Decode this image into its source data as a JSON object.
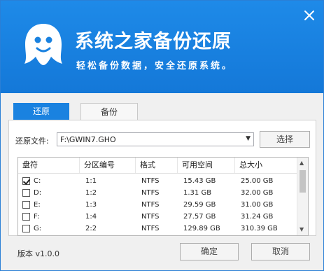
{
  "header": {
    "title": "系统之家备份还原",
    "slogan": "轻松备份数据，安全还原系统。"
  },
  "tabs": [
    {
      "label": "还原",
      "active": true
    },
    {
      "label": "备份",
      "active": false
    }
  ],
  "restore": {
    "file_label": "还原文件:",
    "file_value": "F:\\GWIN7.GHO",
    "browse_label": "选择"
  },
  "partition_table": {
    "columns": [
      "盘符",
      "分区编号",
      "格式",
      "可用空间",
      "总大小"
    ],
    "rows": [
      {
        "checked": true,
        "drive": "C:",
        "partition": "1:1",
        "format": "NTFS",
        "free": "15.43 GB",
        "total": "25.00 GB"
      },
      {
        "checked": false,
        "drive": "D:",
        "partition": "1:2",
        "format": "NTFS",
        "free": "1.31 GB",
        "total": "32.00 GB"
      },
      {
        "checked": false,
        "drive": "E:",
        "partition": "1:3",
        "format": "NTFS",
        "free": "29.59 GB",
        "total": "31.00 GB"
      },
      {
        "checked": false,
        "drive": "F:",
        "partition": "1:4",
        "format": "NTFS",
        "free": "27.57 GB",
        "total": "31.24 GB"
      },
      {
        "checked": false,
        "drive": "G:",
        "partition": "2:2",
        "format": "NTFS",
        "free": "129.89 GB",
        "total": "310.39 GB"
      }
    ]
  },
  "footer": {
    "version": "版本 v1.0.0",
    "ok_label": "确定",
    "cancel_label": "取消"
  },
  "colors": {
    "header_blue": "#1a82e0",
    "accent": "#1a82e0"
  },
  "icons": {
    "logo": "ghost-logo-icon",
    "close": "close-icon",
    "checkbox": "checkbox-icon"
  }
}
